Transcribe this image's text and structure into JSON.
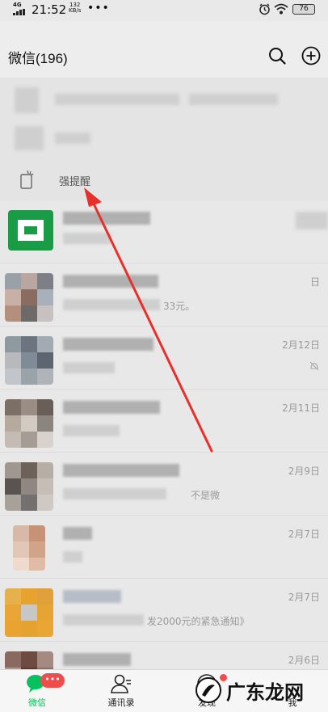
{
  "status_bar": {
    "network": "4G",
    "time": "21:52",
    "speed_value": "132",
    "speed_unit": "KB/s",
    "more": "•••",
    "battery": "76"
  },
  "header": {
    "title": "微信(196)",
    "search_icon": "search-icon",
    "add_icon": "plus-circle-icon"
  },
  "banner": {
    "reminder_label": "强提醒"
  },
  "chats": [
    {
      "date": "",
      "preview": ""
    },
    {
      "date": "日",
      "preview": "33元。"
    },
    {
      "date": "2月12日",
      "preview": "",
      "muted": true
    },
    {
      "date": "2月11日",
      "preview": ""
    },
    {
      "date": "2月9日",
      "preview": "不是微"
    },
    {
      "date": "2月7日",
      "preview": ""
    },
    {
      "date": "2月7日",
      "preview": "发2000元的紧急通知》"
    },
    {
      "date": "2月6日",
      "preview": ""
    }
  ],
  "tabs": [
    {
      "label": "微信",
      "icon": "chat-bubble-icon",
      "badge": "•••"
    },
    {
      "label": "通讯录",
      "icon": "contacts-icon"
    },
    {
      "label": "发现",
      "icon": "compass-icon"
    },
    {
      "label": "我",
      "icon": "person-icon"
    }
  ],
  "watermark": {
    "text": "广东龙网"
  },
  "colors": {
    "accent": "#07c160",
    "badge": "#f14c4c",
    "arrow": "#e8302a"
  }
}
